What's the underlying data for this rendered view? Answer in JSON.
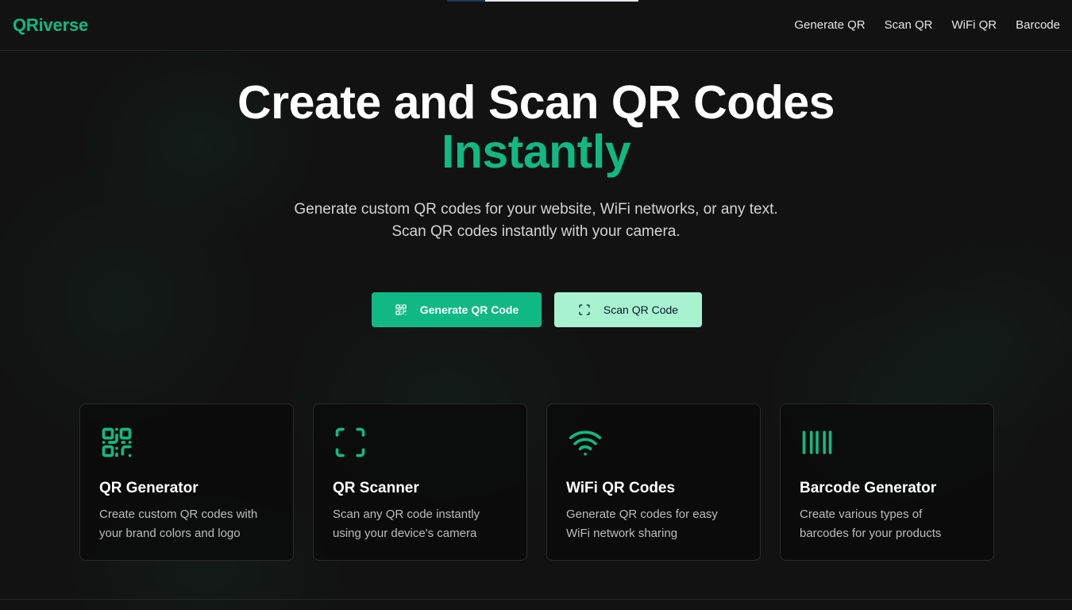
{
  "brand": "QRiverse",
  "nav": {
    "items": [
      "Generate QR",
      "Scan QR",
      "WiFi QR",
      "Barcode"
    ]
  },
  "hero": {
    "title_line1": "Create and Scan QR Codes",
    "title_line2": "Instantly",
    "subtitle_line1": "Generate custom QR codes for your website, WiFi networks, or any text.",
    "subtitle_line2": "Scan QR codes instantly with your camera."
  },
  "cta": {
    "primary_label": "Generate QR Code",
    "secondary_label": "Scan QR Code"
  },
  "features": [
    {
      "icon": "qr-code-icon",
      "title": "QR Generator",
      "description": "Create custom QR codes with your brand colors and logo"
    },
    {
      "icon": "scan-icon",
      "title": "QR Scanner",
      "description": "Scan any QR code instantly using your device's camera"
    },
    {
      "icon": "wifi-icon",
      "title": "WiFi QR Codes",
      "description": "Generate QR codes for easy WiFi network sharing"
    },
    {
      "icon": "barcode-icon",
      "title": "Barcode Generator",
      "description": "Create various types of barcodes for your products"
    }
  ],
  "colors": {
    "accent": "#10b981",
    "accent_light": "#a7f3d0",
    "background": "#121212"
  }
}
